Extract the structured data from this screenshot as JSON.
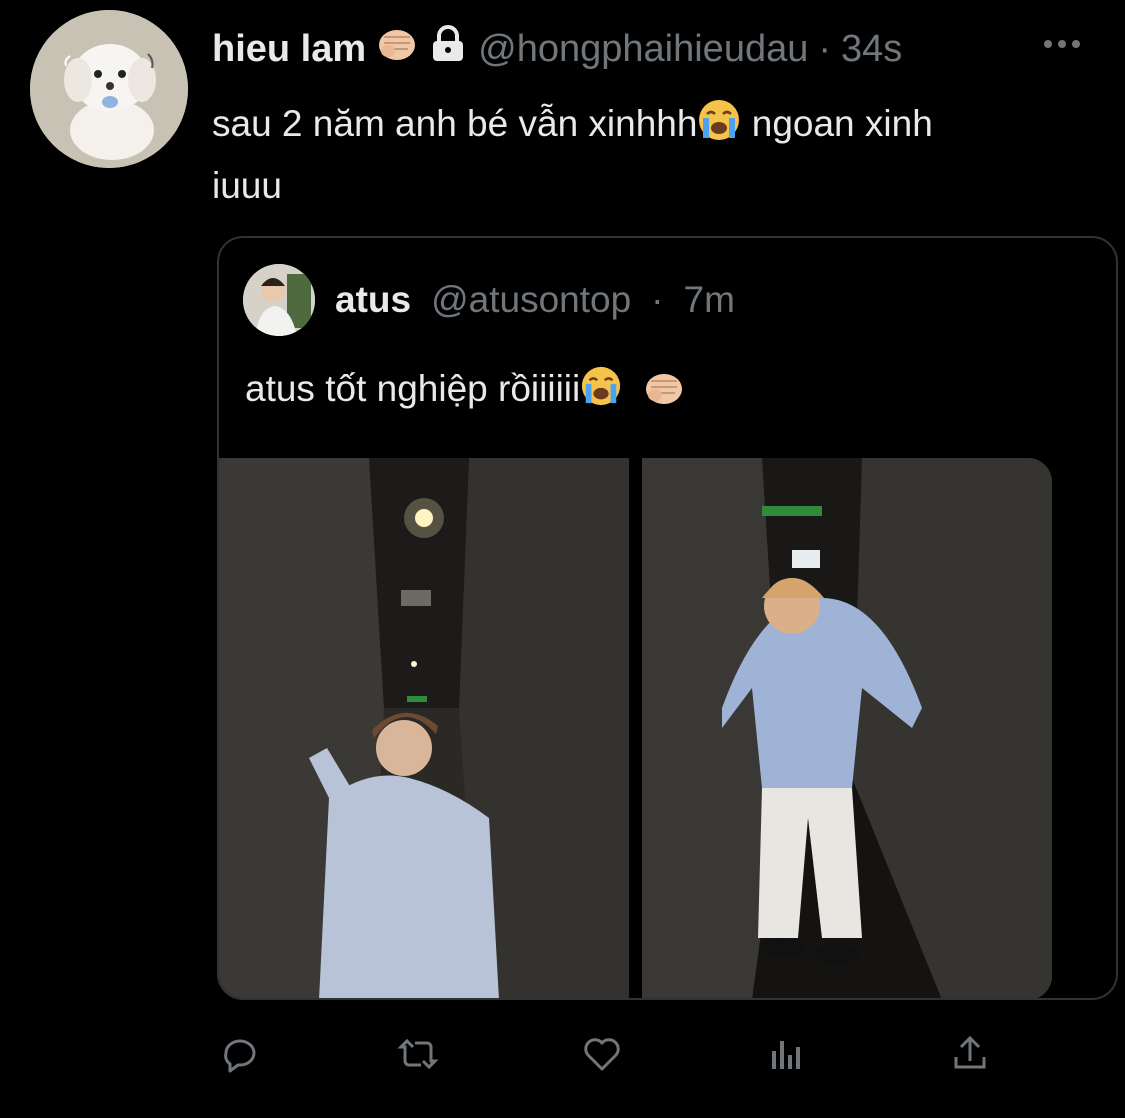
{
  "tweet": {
    "author_name": "hieu lam",
    "handle": "@hongphaihieudau",
    "separator": "·",
    "time": "34s",
    "more_label": "•••",
    "text_line1": "sau 2 năm anh bé vẫn xinhhh",
    "text_line1b": " ngoan xinh",
    "text_line2": "iuuu",
    "icons": [
      "fist-emoji-icon",
      "lock-icon",
      "crying-face-emoji-icon"
    ]
  },
  "quote": {
    "author_name": "atus",
    "handle": "@atusontop",
    "separator": "·",
    "time": "7m",
    "text": "atus tốt nghiệp rồiiiiii",
    "icons": [
      "crying-face-emoji-icon",
      "fist-emoji-icon"
    ]
  },
  "actions": [
    {
      "name": "reply",
      "icon": "reply-icon"
    },
    {
      "name": "retweet",
      "icon": "retweet-icon"
    },
    {
      "name": "like",
      "icon": "heart-icon"
    },
    {
      "name": "analytics",
      "icon": "analytics-icon"
    },
    {
      "name": "share",
      "icon": "share-icon"
    }
  ],
  "colors": {
    "background": "#000000",
    "text": "#e7e9ea",
    "muted": "#71767b",
    "border": "#2f3336"
  }
}
